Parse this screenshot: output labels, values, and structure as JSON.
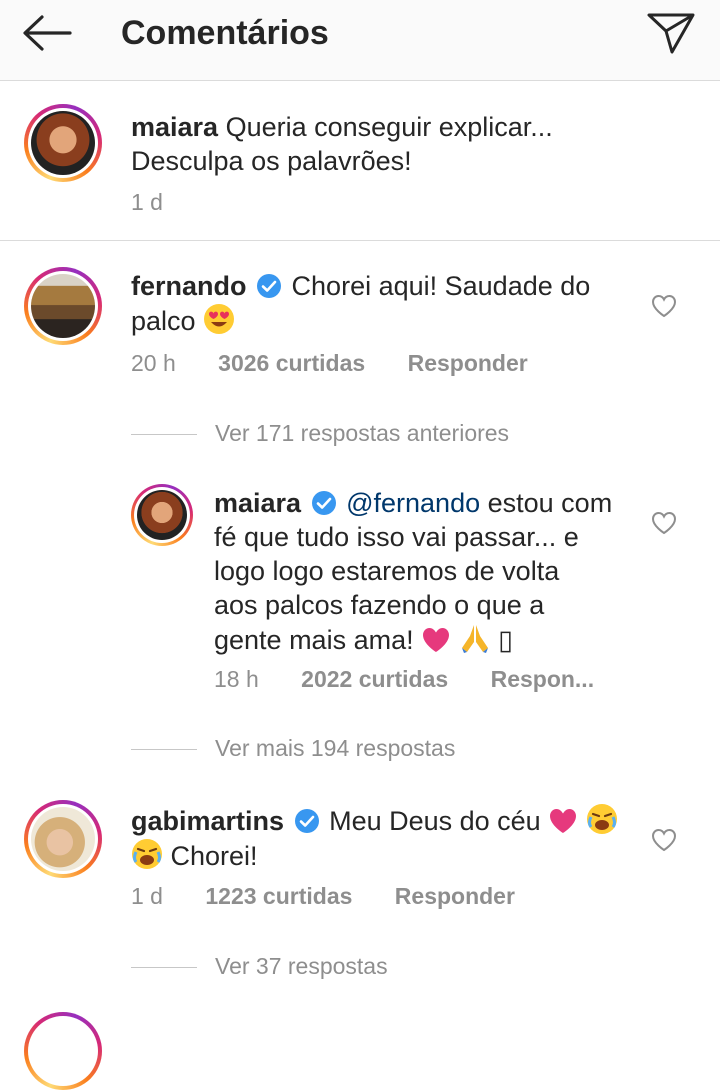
{
  "header": {
    "title": "Comentários",
    "back_icon": "arrow-left-icon",
    "share_icon": "paper-plane-icon"
  },
  "caption": {
    "username": "maiara",
    "text_line1": "Queria conseguir explicar...",
    "text_line2": "Desculpa os palavrões!",
    "time": "1 d"
  },
  "comments": [
    {
      "username": "fernando",
      "verified": true,
      "text_line1": "Chorei aqui! Saudade do",
      "text_line2": "palco",
      "emoji": "heart-eyes-emoji",
      "time": "20 h",
      "likes": "3026 curtidas",
      "reply": "Responder",
      "view_prev": "Ver 171 respostas anteriores",
      "reply_item": {
        "username": "maiara",
        "verified": true,
        "mention": "@fernando",
        "text_line1": "estou com",
        "text_line2": "fé que tudo isso vai passar... e",
        "text_line3": "logo logo estaremos de volta",
        "text_line4": "aos palcos fazendo o que a",
        "text_line5": "gente mais ama!",
        "emojis": [
          "pink-heart-emoji",
          "folded-hands-emoji"
        ],
        "trailing_glyph": "▯",
        "time": "18 h",
        "likes": "2022 curtidas",
        "reply": "Respon..."
      },
      "view_more": "Ver mais 194 respostas"
    },
    {
      "username": "gabimartins",
      "verified": true,
      "text_line1": "Meu Deus do céu",
      "text_line2": "Chorei!",
      "emojis": [
        "pink-heart-emoji",
        "crying-face-emoji",
        "crying-face-emoji"
      ],
      "time": "1 d",
      "likes": "1223 curtidas",
      "reply": "Responder",
      "view_more": "Ver 37 respostas"
    }
  ],
  "colors": {
    "text": "#262626",
    "meta": "#8e8e8e",
    "mention": "#00376b",
    "verified": "#3897f0",
    "heart_pink": "#e6397d"
  }
}
